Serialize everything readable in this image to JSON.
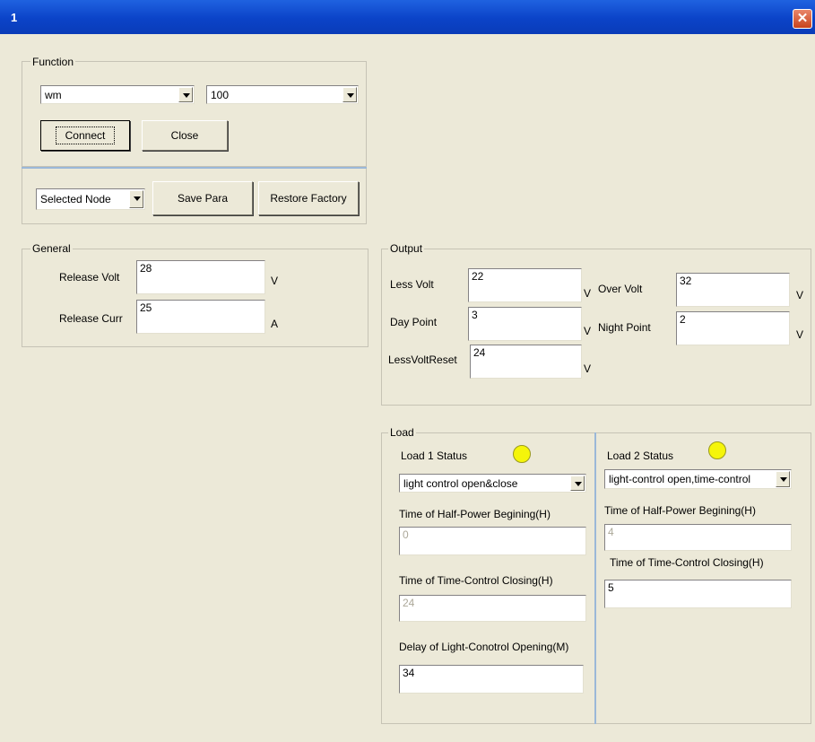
{
  "window": {
    "title": "1",
    "close_glyph": "✕"
  },
  "function": {
    "legend": "Function",
    "port": "wm",
    "baud": "100",
    "connect": "Connect",
    "close": "Close",
    "node": "Selected Node",
    "save": "Save Para",
    "restore": "Restore Factory"
  },
  "general": {
    "legend": "General",
    "release_volt": {
      "label": "Release Volt",
      "value": "28",
      "unit": "V"
    },
    "release_curr": {
      "label": "Release Curr",
      "value": "25",
      "unit": "A"
    }
  },
  "output": {
    "legend": "Output",
    "less_volt": {
      "label": "Less Volt",
      "value": "22",
      "unit": "V"
    },
    "over_volt": {
      "label": "Over Volt",
      "value": "32",
      "unit": "V"
    },
    "day_point": {
      "label": "Day Point",
      "value": "3",
      "unit": "V"
    },
    "night_point": {
      "label": "Night Point",
      "value": "2",
      "unit": "V"
    },
    "less_volt_reset": {
      "label": "LessVoltReset",
      "value": "24",
      "unit": "V"
    }
  },
  "load": {
    "legend": "Load",
    "load1": {
      "status_label": "Load 1 Status",
      "mode": "light control open&close",
      "half_power_label": "Time of Half-Power Begining(H)",
      "half_power_value": "0",
      "time_close_label": "Time of Time-Control Closing(H)",
      "time_close_value": "24",
      "delay_label": "Delay of Light-Conotrol Opening(M)",
      "delay_value": "34"
    },
    "load2": {
      "status_label": "Load 2 Status",
      "mode": "light-control open,time-control",
      "half_power_label": "Time of Half-Power Begining(H)",
      "half_power_value": "4",
      "time_close_label": "Time of Time-Control Closing(H)",
      "time_close_value": "5"
    },
    "status_color": "#f5f50a"
  }
}
